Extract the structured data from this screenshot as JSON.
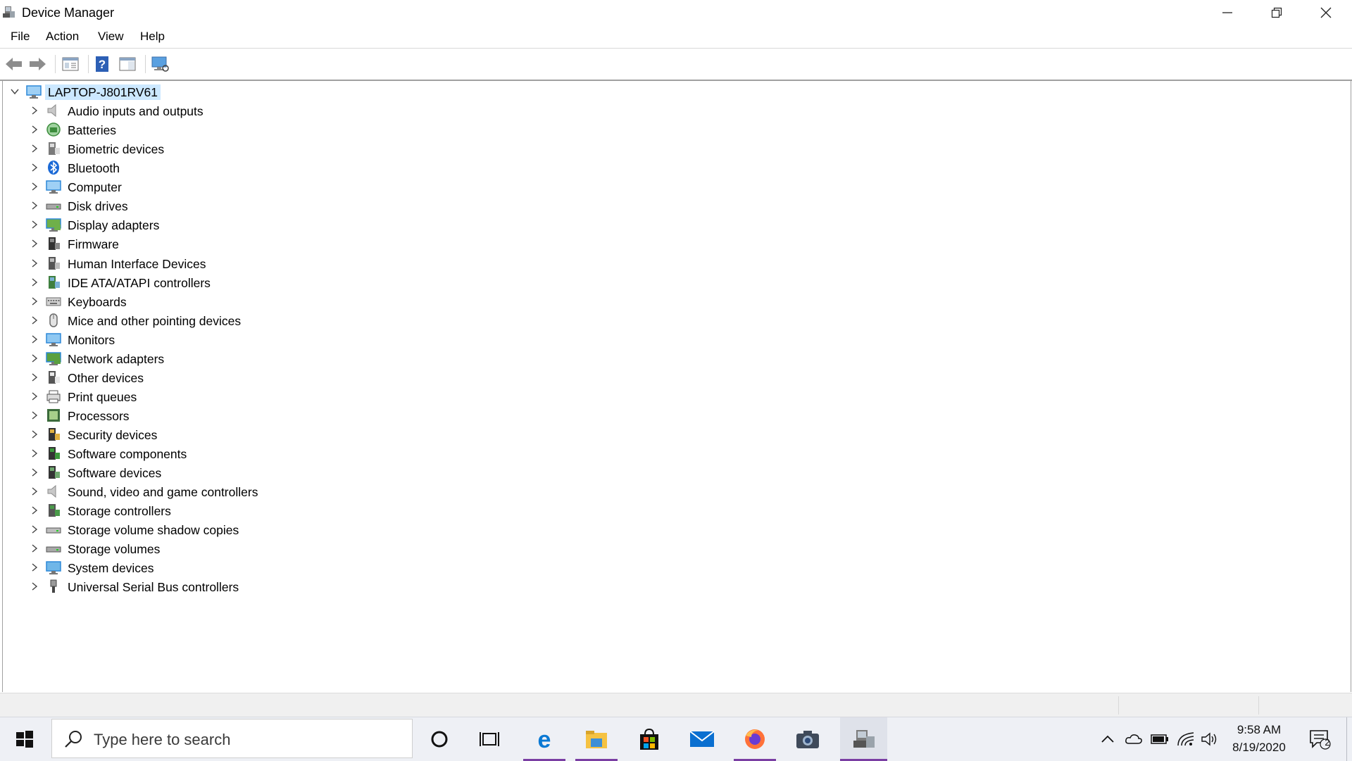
{
  "window": {
    "title": "Device Manager",
    "controls": [
      "minimize",
      "restore",
      "close"
    ]
  },
  "menu": [
    "File",
    "Action",
    "View",
    "Help"
  ],
  "toolbar": {
    "buttons": [
      "back-arrow-icon",
      "forward-arrow-icon",
      "properties-icon",
      "help-icon",
      "show-hide-console-icon",
      "scan-hardware-icon"
    ]
  },
  "tree": {
    "root": "LAPTOP-J801RV61",
    "categories": [
      {
        "label": "Audio inputs and outputs",
        "icon": "speaker-icon"
      },
      {
        "label": "Batteries",
        "icon": "battery-icon"
      },
      {
        "label": "Biometric devices",
        "icon": "biometric-icon"
      },
      {
        "label": "Bluetooth",
        "icon": "bluetooth-icon"
      },
      {
        "label": "Computer",
        "icon": "computer-icon"
      },
      {
        "label": "Disk drives",
        "icon": "disk-drive-icon"
      },
      {
        "label": "Display adapters",
        "icon": "display-adapter-icon"
      },
      {
        "label": "Firmware",
        "icon": "firmware-icon"
      },
      {
        "label": "Human Interface Devices",
        "icon": "hid-icon"
      },
      {
        "label": "IDE ATA/ATAPI controllers",
        "icon": "ide-controller-icon"
      },
      {
        "label": "Keyboards",
        "icon": "keyboard-icon"
      },
      {
        "label": "Mice and other pointing devices",
        "icon": "mouse-icon"
      },
      {
        "label": "Monitors",
        "icon": "monitor-icon"
      },
      {
        "label": "Network adapters",
        "icon": "network-adapter-icon"
      },
      {
        "label": "Other devices",
        "icon": "unknown-device-icon"
      },
      {
        "label": "Print queues",
        "icon": "printer-icon"
      },
      {
        "label": "Processors",
        "icon": "processor-icon"
      },
      {
        "label": "Security devices",
        "icon": "security-device-icon"
      },
      {
        "label": "Software components",
        "icon": "software-component-icon"
      },
      {
        "label": "Software devices",
        "icon": "software-device-icon"
      },
      {
        "label": "Sound, video and game controllers",
        "icon": "sound-controller-icon"
      },
      {
        "label": "Storage controllers",
        "icon": "storage-controller-icon"
      },
      {
        "label": "Storage volume shadow copies",
        "icon": "shadow-copy-icon"
      },
      {
        "label": "Storage volumes",
        "icon": "storage-volume-icon"
      },
      {
        "label": "System devices",
        "icon": "system-devices-icon"
      },
      {
        "label": "Universal Serial Bus controllers",
        "icon": "usb-icon"
      }
    ]
  },
  "taskbar": {
    "search_placeholder": "Type here to search",
    "apps": [
      "cortana-icon",
      "task-view-icon",
      "edge-icon",
      "file-explorer-icon",
      "store-icon",
      "mail-icon",
      "firefox-icon",
      "camera-icon",
      "device-manager-icon"
    ],
    "clock_time": "9:58 AM",
    "clock_date": "8/19/2020",
    "notification_count": "2",
    "colors": {
      "accent": "#0078d7",
      "active_underline": "#7a3ea3"
    }
  }
}
